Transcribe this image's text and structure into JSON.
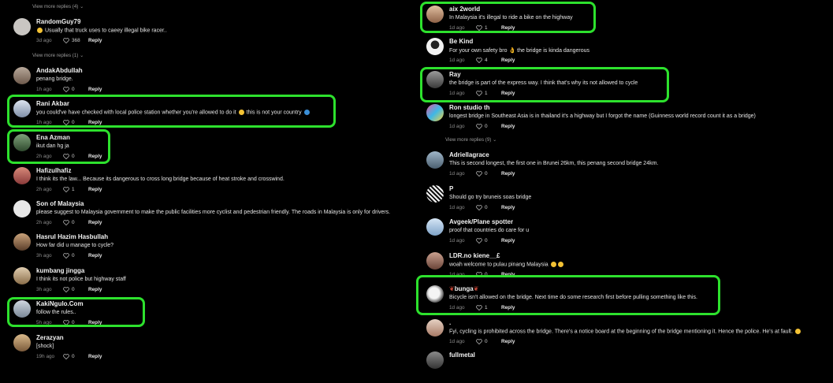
{
  "left_column": {
    "view_more_top": "View more replies (4)",
    "view_more_mid": "View more replies (1)",
    "comments": [
      {
        "user": "RandomGuy79",
        "text": "Usually that truck uses to caeey illegal bike racer..",
        "time": "3d ago",
        "likes": "368",
        "reply": "Reply"
      },
      {
        "user": "AndakAbdullah",
        "text": "penang bridge.",
        "time": "1h ago",
        "likes": "0",
        "reply": "Reply"
      },
      {
        "user": "Rani Akbar",
        "text": "you could've have checked with local police station whether you're allowed to do it",
        "text_tail": "this is not your country",
        "time": "1h ago",
        "likes": "0",
        "reply": "Reply"
      },
      {
        "user": "Ena Azman",
        "text": "ikut dan hg ja",
        "time": "2h ago",
        "likes": "0",
        "reply": "Reply"
      },
      {
        "user": "Hafizulhafiz",
        "text": "I think its the law... Because its dangerous to cross long bridge because of heat stroke and crosswind.",
        "time": "2h ago",
        "likes": "1",
        "reply": "Reply"
      },
      {
        "user": "Son of Malaysia",
        "text": "please suggest to Malaysia government to make the public facilities more cyclist and pedestrian friendly. The roads in Malaysia is only for drivers.",
        "time": "2h ago",
        "likes": "0",
        "reply": "Reply"
      },
      {
        "user": "Hasrul Hazim Hasbullah",
        "text": "How far did u manage to cycle?",
        "time": "3h ago",
        "likes": "0",
        "reply": "Reply"
      },
      {
        "user": "kumbang jingga",
        "text": "I think its not police but highway staff",
        "time": "3h ago",
        "likes": "0",
        "reply": "Reply"
      },
      {
        "user": "KakiNgulo.Com",
        "text": "follow the rules..",
        "time": "5h ago",
        "likes": "0",
        "reply": "Reply"
      },
      {
        "user": "Zerazyan",
        "text": "[shock]",
        "time": "19h ago",
        "likes": "0",
        "reply": "Reply"
      }
    ]
  },
  "right_column": {
    "view_more": "View more replies (9)",
    "comments": [
      {
        "user": "aix 2world",
        "text": "In Malaysia it's illegal to ride a bike on the highway",
        "time": "1d ago",
        "likes": "1",
        "reply": "Reply"
      },
      {
        "user": "Be Kind",
        "text": "For your own safety bro",
        "text_tail": "the bridge is kinda dangerous",
        "time": "1d ago",
        "likes": "4",
        "reply": "Reply"
      },
      {
        "user": "Ray",
        "text": "the bridge is part of the express way. I think that's why its not allowed to cycle",
        "time": "1d ago",
        "likes": "1",
        "reply": "Reply"
      },
      {
        "user": "Ron studio th",
        "text": "longest bridge in Southeast Asia is in thailand it's a highway but I forgot the name (Guinness world record count it as a bridge)",
        "time": "1d ago",
        "likes": "0",
        "reply": "Reply"
      },
      {
        "user": "Adriellagrace",
        "text": "This is second longest, the first one in Brunei 26km, this penang second bridge 24km.",
        "time": "1d ago",
        "likes": "0",
        "reply": "Reply"
      },
      {
        "user": "P",
        "text": "Should go try bruneis soas bridge",
        "time": "1d ago",
        "likes": "0",
        "reply": "Reply"
      },
      {
        "user": "Avgeek/Plane spotter",
        "text": "proof that countries do care for u",
        "time": "1d ago",
        "likes": "0",
        "reply": "Reply"
      },
      {
        "user": "LDR.no kiene__£",
        "text": "woah welcome to pulau pinang Malaysia",
        "time": "1d ago",
        "likes": "0",
        "reply": "Reply"
      },
      {
        "user": "bunga",
        "text": "Bicycle isn't allowed on the bridge. Next time do some research first before pulling something like this.",
        "time": "1d ago",
        "likes": "1",
        "reply": "Reply"
      },
      {
        "user": ".",
        "text": "Fyi, cycling is prohibited across the bridge. There's a notice board at the beginning of the bridge mentioning it. Hence the police. He's at fault.",
        "time": "1d ago",
        "likes": "0",
        "reply": "Reply"
      },
      {
        "user": "fullmetal",
        "text": "",
        "time": "",
        "likes": "",
        "reply": ""
      }
    ]
  },
  "colors": {
    "highlight": "#2de12d",
    "background": "#000000",
    "meta_text": "#8a8a8a"
  }
}
